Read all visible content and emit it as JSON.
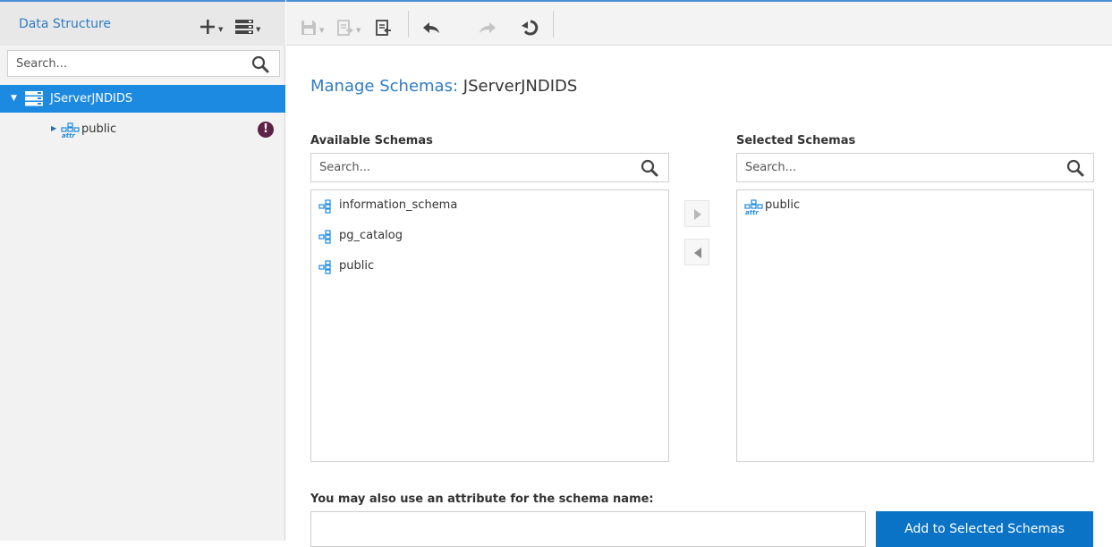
{
  "left_panel": {
    "title": "Data Structure",
    "search": {
      "placeholder": "Search...",
      "value": ""
    },
    "tree": {
      "root": {
        "label": "JServerJNDIDS",
        "expanded": true,
        "selected": true,
        "icon": "server-icon"
      },
      "children": [
        {
          "label": "public",
          "icon": "schema-attr-icon",
          "expanded": false,
          "status_icon": "warning-icon",
          "status_mark": "!"
        }
      ]
    },
    "header_buttons": [
      {
        "name": "add-menu-button",
        "icon": "plus-icon"
      },
      {
        "name": "datasource-menu-button",
        "icon": "server-stack-icon"
      }
    ]
  },
  "toolbar": {
    "buttons": [
      {
        "name": "save-button",
        "icon": "save-icon",
        "enabled": false,
        "dropdown": true
      },
      {
        "name": "export-button",
        "icon": "export-icon",
        "enabled": false,
        "dropdown": true
      },
      {
        "name": "import-button",
        "icon": "import-icon",
        "enabled": true,
        "dropdown": false
      },
      {
        "name": "undo-button",
        "icon": "undo-icon",
        "enabled": true
      },
      {
        "name": "redo-button",
        "icon": "redo-icon",
        "enabled": false
      },
      {
        "name": "revert-button",
        "icon": "revert-icon",
        "enabled": true
      }
    ]
  },
  "main": {
    "title_prefix": "Manage Schemas:",
    "title_name": "JServerJNDIDS",
    "available": {
      "label": "Available Schemas",
      "search_placeholder": "Search...",
      "items": [
        {
          "label": "information_schema",
          "icon": "schema-icon"
        },
        {
          "label": "pg_catalog",
          "icon": "schema-icon"
        },
        {
          "label": "public",
          "icon": "schema-icon"
        }
      ]
    },
    "selected": {
      "label": "Selected Schemas",
      "search_placeholder": "Search...",
      "items": [
        {
          "label": "public",
          "icon": "schema-attr-icon"
        }
      ]
    },
    "move_buttons": [
      {
        "name": "move-right-button",
        "icon": "arrow-right-icon"
      },
      {
        "name": "move-left-button",
        "icon": "arrow-left-icon"
      }
    ],
    "attribute": {
      "label": "You may also use an attribute for the schema name:",
      "value": "",
      "button_label": "Add to Selected Schemas"
    }
  },
  "colors": {
    "accent_blue": "#1c8ae0",
    "title_blue": "#2f7cc4",
    "primary_button": "#0a73c6",
    "warning_purple": "#5e2248"
  }
}
